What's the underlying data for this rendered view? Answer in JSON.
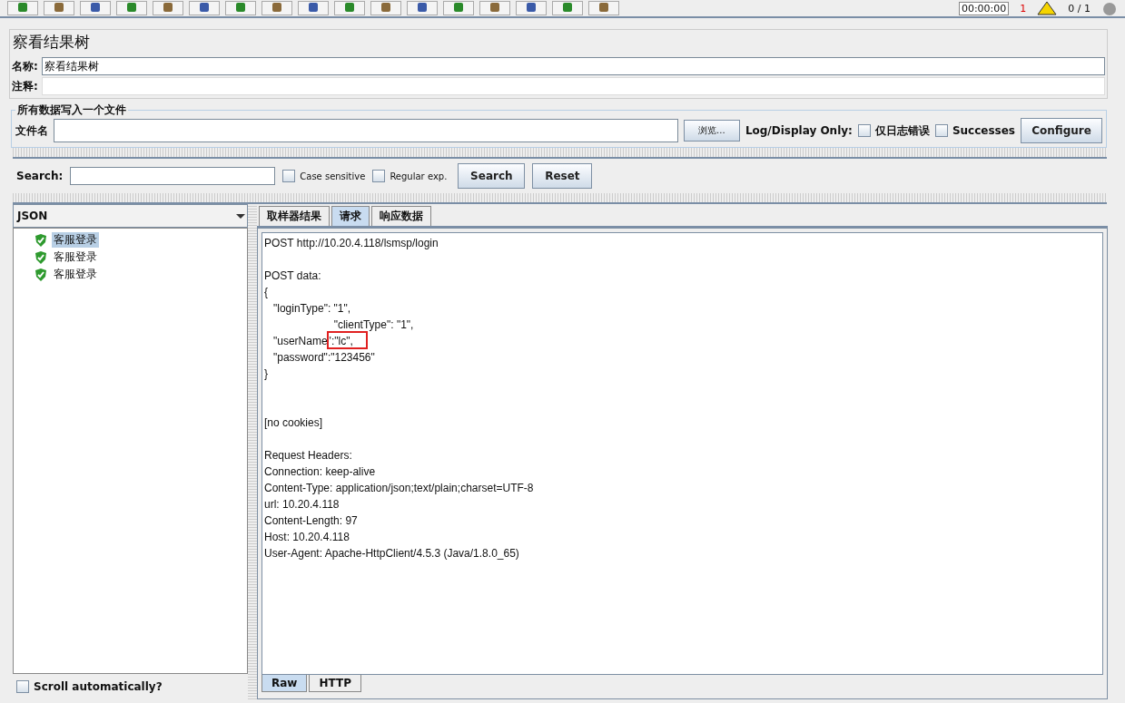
{
  "toolbar": {
    "timer": "00:00:00",
    "error_count": "1",
    "thread_count": "0 / 1"
  },
  "panel": {
    "title": "察看结果树",
    "name_label": "名称:",
    "name_value": "察看结果树",
    "comment_label": "注释:"
  },
  "file_section": {
    "legend": "所有数据写入一个文件",
    "file_label": "文件名",
    "browse": "浏览...",
    "log_label": "Log/Display Only:",
    "options": [
      {
        "label": "仅日志错误",
        "checked": false
      },
      {
        "label": "Successes",
        "checked": false
      }
    ],
    "configure": "Configure"
  },
  "search": {
    "label": "Search:",
    "options": [
      {
        "label": "Case sensitive",
        "checked": false
      },
      {
        "label": "Regular exp.",
        "checked": false
      }
    ],
    "search_button": "Search",
    "reset_button": "Reset"
  },
  "renderer": {
    "value": "JSON"
  },
  "tree": [
    {
      "label": "客服登录",
      "selected": true
    },
    {
      "label": "客服登录",
      "selected": false
    },
    {
      "label": "客服登录",
      "selected": false
    }
  ],
  "scroll_auto": {
    "label": "Scroll automatically?",
    "checked": false
  },
  "tabs": [
    {
      "label": "取样器结果",
      "selected": false
    },
    {
      "label": "请求",
      "selected": true
    },
    {
      "label": "响应数据",
      "selected": false
    }
  ],
  "request_lines": [
    {
      "kind": "text",
      "text": "POST http://10.20.4.118/lsmsp/login"
    },
    {
      "kind": "blank"
    },
    {
      "kind": "text",
      "text": "POST data:"
    },
    {
      "kind": "text",
      "text": "{"
    },
    {
      "kind": "text",
      "text": "   \"loginType\": \"1\","
    },
    {
      "kind": "text",
      "text": "                       \"clientType\": \"1\","
    },
    {
      "kind": "text",
      "text": "   \"userName\":\"lc\",",
      "highlight": true
    },
    {
      "kind": "text",
      "text": "   \"password\":\"123456\""
    },
    {
      "kind": "text",
      "text": "}"
    },
    {
      "kind": "blank"
    },
    {
      "kind": "blank"
    },
    {
      "kind": "text",
      "text": "[no cookies]"
    },
    {
      "kind": "blank"
    },
    {
      "kind": "text",
      "text": "Request Headers:"
    },
    {
      "kind": "text",
      "text": "Connection: keep-alive"
    },
    {
      "kind": "text",
      "text": "Content-Type: application/json;text/plain;charset=UTF-8"
    },
    {
      "kind": "text",
      "text": "url: 10.20.4.118"
    },
    {
      "kind": "text",
      "text": "Content-Length: 97"
    },
    {
      "kind": "text",
      "text": "Host: 10.20.4.118"
    },
    {
      "kind": "text",
      "text": "User-Agent: Apache-HttpClient/4.5.3 (Java/1.8.0_65)"
    }
  ],
  "bottom_tabs": [
    {
      "label": "Raw",
      "selected": true
    },
    {
      "label": "HTTP",
      "selected": false
    }
  ]
}
